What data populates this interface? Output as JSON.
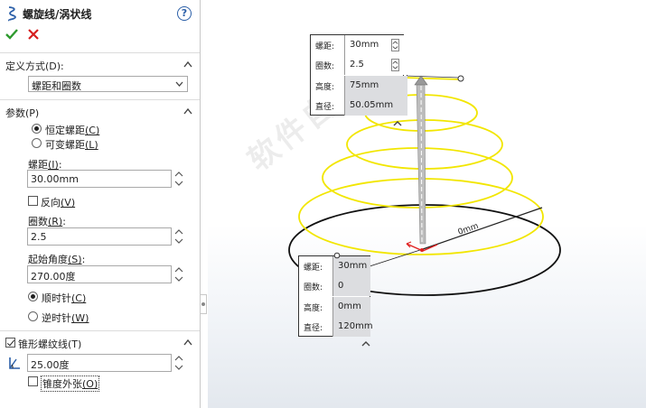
{
  "panel": {
    "title": "螺旋线/涡状线",
    "help_label": "?",
    "icons": {
      "title": "helix-icon",
      "ok": "checkmark-icon",
      "cancel": "x-icon",
      "help": "help-icon",
      "taper": "taper-angle-icon"
    },
    "colors": {
      "ok": "#2e9a2e",
      "cancel": "#d61e1e",
      "help": "#2b5fa8"
    },
    "definition": {
      "label": "定义方式",
      "key": "(D):",
      "selected": "螺距和圈数"
    },
    "params": {
      "label": "参数",
      "key": "(P)",
      "radio_constant": {
        "text": "恒定螺距",
        "key": "(C)",
        "checked": true
      },
      "radio_variable": {
        "text": "可变螺距",
        "key": "(L)",
        "checked": false
      },
      "pitch_label": "螺距",
      "pitch_key": "(I)",
      "pitch_value": "30.00mm",
      "reverse_label": "反向",
      "reverse_key": "(V)",
      "reverse_checked": false,
      "revolutions_label": "圈数",
      "revolutions_key": "(R)",
      "revolutions_value": "2.5",
      "start_angle_label": "起始角度",
      "start_angle_key": "(S)",
      "start_angle_value": "270.00度",
      "cw": {
        "text": "顺时针",
        "key": "(C)",
        "checked": true
      },
      "ccw": {
        "text": "逆时针",
        "key": "(W)",
        "checked": false
      }
    },
    "taper": {
      "label": "锥形螺纹线",
      "key": "(T)",
      "checked": true,
      "angle_value": "25.00度",
      "outward_label": "锥度外张",
      "outward_key": "(O)",
      "outward_checked": false
    }
  },
  "viewport": {
    "watermark": "软件自学网",
    "top_callout": [
      {
        "k": "螺距:",
        "v": "30mm"
      },
      {
        "k": "圈数:",
        "v": "2.5"
      },
      {
        "k": "高度:",
        "v": "75mm"
      },
      {
        "k": "直径:",
        "v": "50.05mm"
      }
    ],
    "bottom_callout": [
      {
        "k": "螺距:",
        "v": "30mm"
      },
      {
        "k": "圈数:",
        "v": "0"
      },
      {
        "k": "高度:",
        "v": "0mm"
      },
      {
        "k": "直径:",
        "v": "120mm"
      }
    ],
    "dimension_label": "0mm",
    "colors": {
      "helix": "#f2e600",
      "base_circle": "#111111",
      "axis": "#999999",
      "origin": "#e02020"
    }
  }
}
